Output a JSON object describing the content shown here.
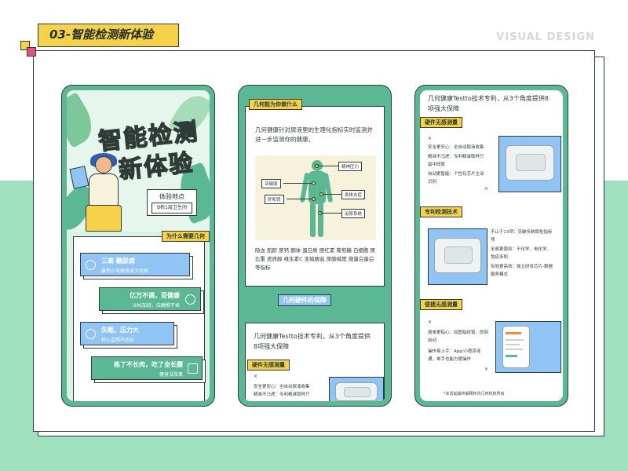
{
  "header": {
    "section_title": "03-智能检测新体验",
    "watermark": "VISUAL DESIGN"
  },
  "phone1": {
    "hero_title_line1": "智能检测",
    "hero_title_line2": "新体验",
    "location_title": "体验地点",
    "location_value": "B栋1层卫生间",
    "section_tag": "为什么需要几何",
    "items": [
      {
        "title": "三高  糖尿病",
        "subtitle": "最怕小毛病变成大毛病"
      },
      {
        "title": "亿万不调，亚健康",
        "subtitle": "996加班，应酬推不掉"
      },
      {
        "title": "失眠，压力大",
        "subtitle": "担心金感不达标"
      },
      {
        "title": "练了不长肉，吃了全长膘",
        "subtitle": "健身没效果"
      }
    ]
  },
  "phone2": {
    "section_tag": "几何能为你做什么",
    "intro": "几何健康针对尿液里的生理化指标实时监测并进一步监测你的健康。",
    "diagram_labels": [
      "精神压力",
      "亚健康",
      "身体炎症",
      "肝和肾",
      "泌尿系统"
    ],
    "indicators": "隐血 肌酐 尿钙 酮体 蛋白质 胆红素 葡萄糖 白细胞 尿比重 皮质醇 维生素C 亚硝酸盐 尿酸碱度 微量白蛋白 等指标",
    "section2_tag": "几何硬件的保障",
    "section2_text": "几何健康Testto技术专利，从3个角度提供8项强大保障",
    "sub_tag": "硬件无感测量",
    "sub_lines": [
      "安全更安心：全自动尿液收集",
      "精准不马虎：专利精准取样只"
    ]
  },
  "phone3": {
    "intro": "几何健康Testto技术专利，从3个角度提供8项强大保障",
    "block1_tag": "硬件无感测量",
    "block1_lines": [
      "安全更安心：全自动尿液收集",
      "精准不马虎：专利精准取样只留中段尿",
      "自动更智能：个性化芯片主动识别"
    ],
    "block2_tag": "专利检测技术",
    "block2_lines": [
      "不止于13项：突破传统尿检指标项",
      "全面更周到：干化学、电化学、免疫多和",
      "有效更高效：独立研发芯片-数据服务模式"
    ],
    "block3_tag": "便捷无感测量",
    "block3_lines": [
      "简单更贴心：如图指纹锁，即刻启动",
      "操作易上手：App/小程序连通，单手也能方便操作"
    ],
    "footnote": "*本活动最终解释权归几何科技所有"
  },
  "colors": {
    "green": "#5ab895",
    "yellow": "#f6d24a",
    "blue": "#8fc4f4",
    "pink": "#e7517a",
    "ink": "#2e3b36"
  }
}
